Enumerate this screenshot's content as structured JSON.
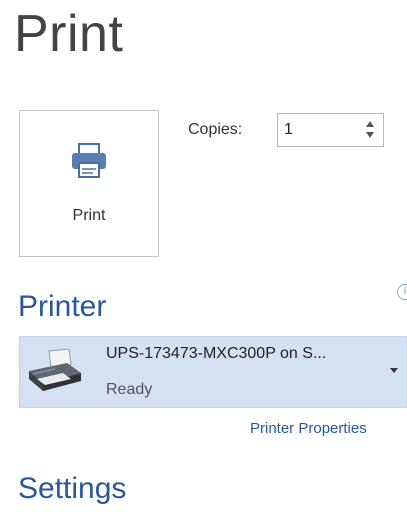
{
  "page": {
    "title": "Print"
  },
  "print_button": {
    "label": "Print",
    "icon": "printer-icon"
  },
  "copies": {
    "label": "Copies:",
    "value": "1"
  },
  "printer_section": {
    "title": "Printer",
    "info_icon": "info-icon",
    "info_glyph": "i",
    "selected_printer": {
      "name": "UPS-173473-MXC300P on S...",
      "status": "Ready",
      "icon": "printer-device-icon"
    },
    "properties_link": "Printer Properties"
  },
  "settings_section": {
    "title": "Settings"
  },
  "colors": {
    "accent": "#2b579a",
    "selected_bg": "#d5e1f2"
  }
}
